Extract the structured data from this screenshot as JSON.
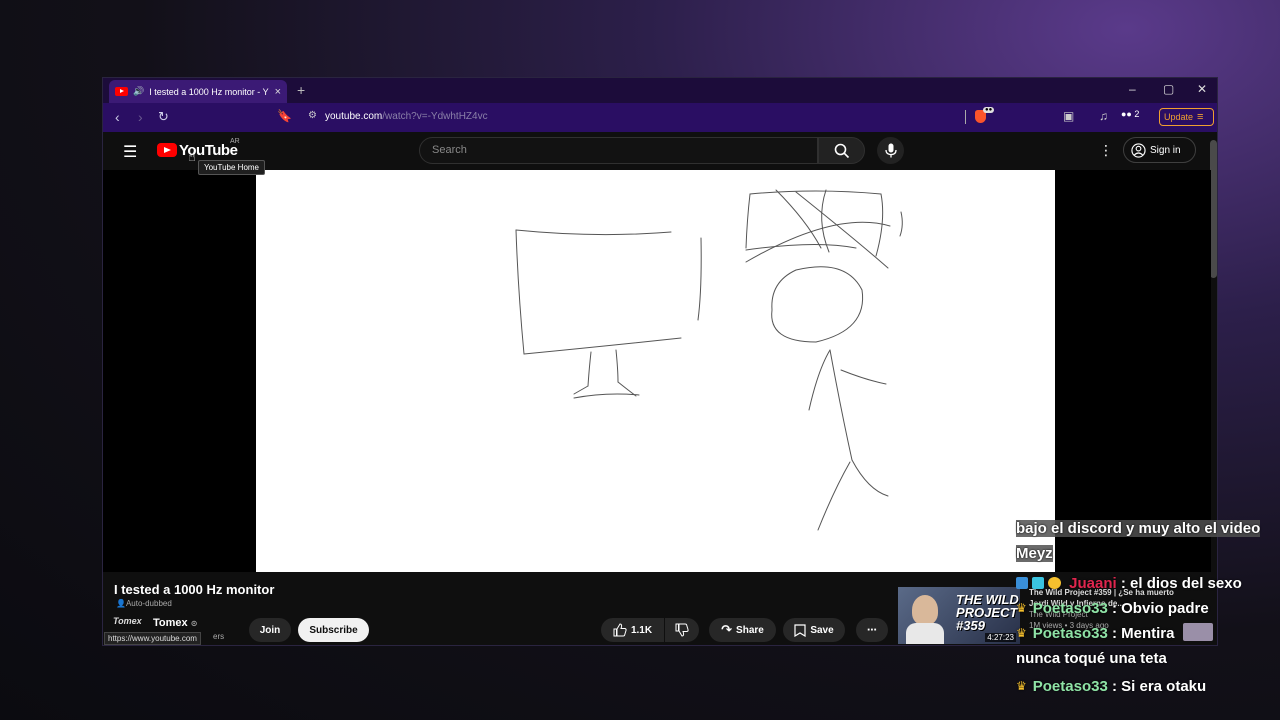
{
  "browser": {
    "tab_title": "I tested a 1000 Hz monitor - Y",
    "tab_close": "×",
    "new_tab": "+",
    "url_host": "youtube.com",
    "url_path": "/watch?v=-YdwhtHZ4vc",
    "ext_count": "2",
    "update_label": "Update",
    "minimize": "–",
    "maximize": "▢",
    "close": "✕"
  },
  "youtube": {
    "logo_text": "YouTube",
    "region": "AR",
    "home_tooltip": "YouTube Home",
    "search_placeholder": "Search",
    "signin_label": "Sign in"
  },
  "video": {
    "title": "I tested a 1000 Hz monitor",
    "auto_dubbed": "Auto-dubbed",
    "channel_name": "Tomex",
    "channel_avatar_text": "Tomex",
    "subscribers": "ers",
    "link_tooltip": "https://www.youtube.com",
    "join_label": "Join",
    "subscribe_label": "Subscribe",
    "likes": "1.1K",
    "share_label": "Share",
    "save_label": "Save",
    "more_label": "⋯"
  },
  "recommendation": {
    "title": "The Wild Project #359 | ¿Se ha muerto Jordi Wild y Infierno de...",
    "channel": "The Wild Project",
    "meta": "1M views • 3 days ago",
    "thumb_title": "THE WILD PROJECT #359",
    "duration": "4:27:23"
  },
  "chat": [
    {
      "user": "",
      "text": "bajo el discord y muy alto el video",
      "highlight": true
    },
    {
      "user": "",
      "text": "Meyz",
      "highlight": true
    },
    {
      "user": "Juaani",
      "text": " : el dios del sexo",
      "color": "#e0264e",
      "badge": "multi"
    },
    {
      "user": "Poetaso33",
      "text": " : Obvio padre",
      "color": "#8fe3a6",
      "badge": "crown"
    },
    {
      "user": "Poetaso33",
      "text": " : Mentira",
      "color": "#8fe3a6",
      "badge": "crown"
    },
    {
      "user": "",
      "text": "nunca toqué una teta"
    },
    {
      "user": "Poetaso33",
      "text": " : Si era otaku",
      "color": "#8fe3a6",
      "badge": "crown"
    }
  ],
  "colors": {
    "titlebar": "#1c0c3a",
    "navbar": "#2a0e63",
    "yt_red": "#ff0000",
    "update": "#f0a030"
  }
}
